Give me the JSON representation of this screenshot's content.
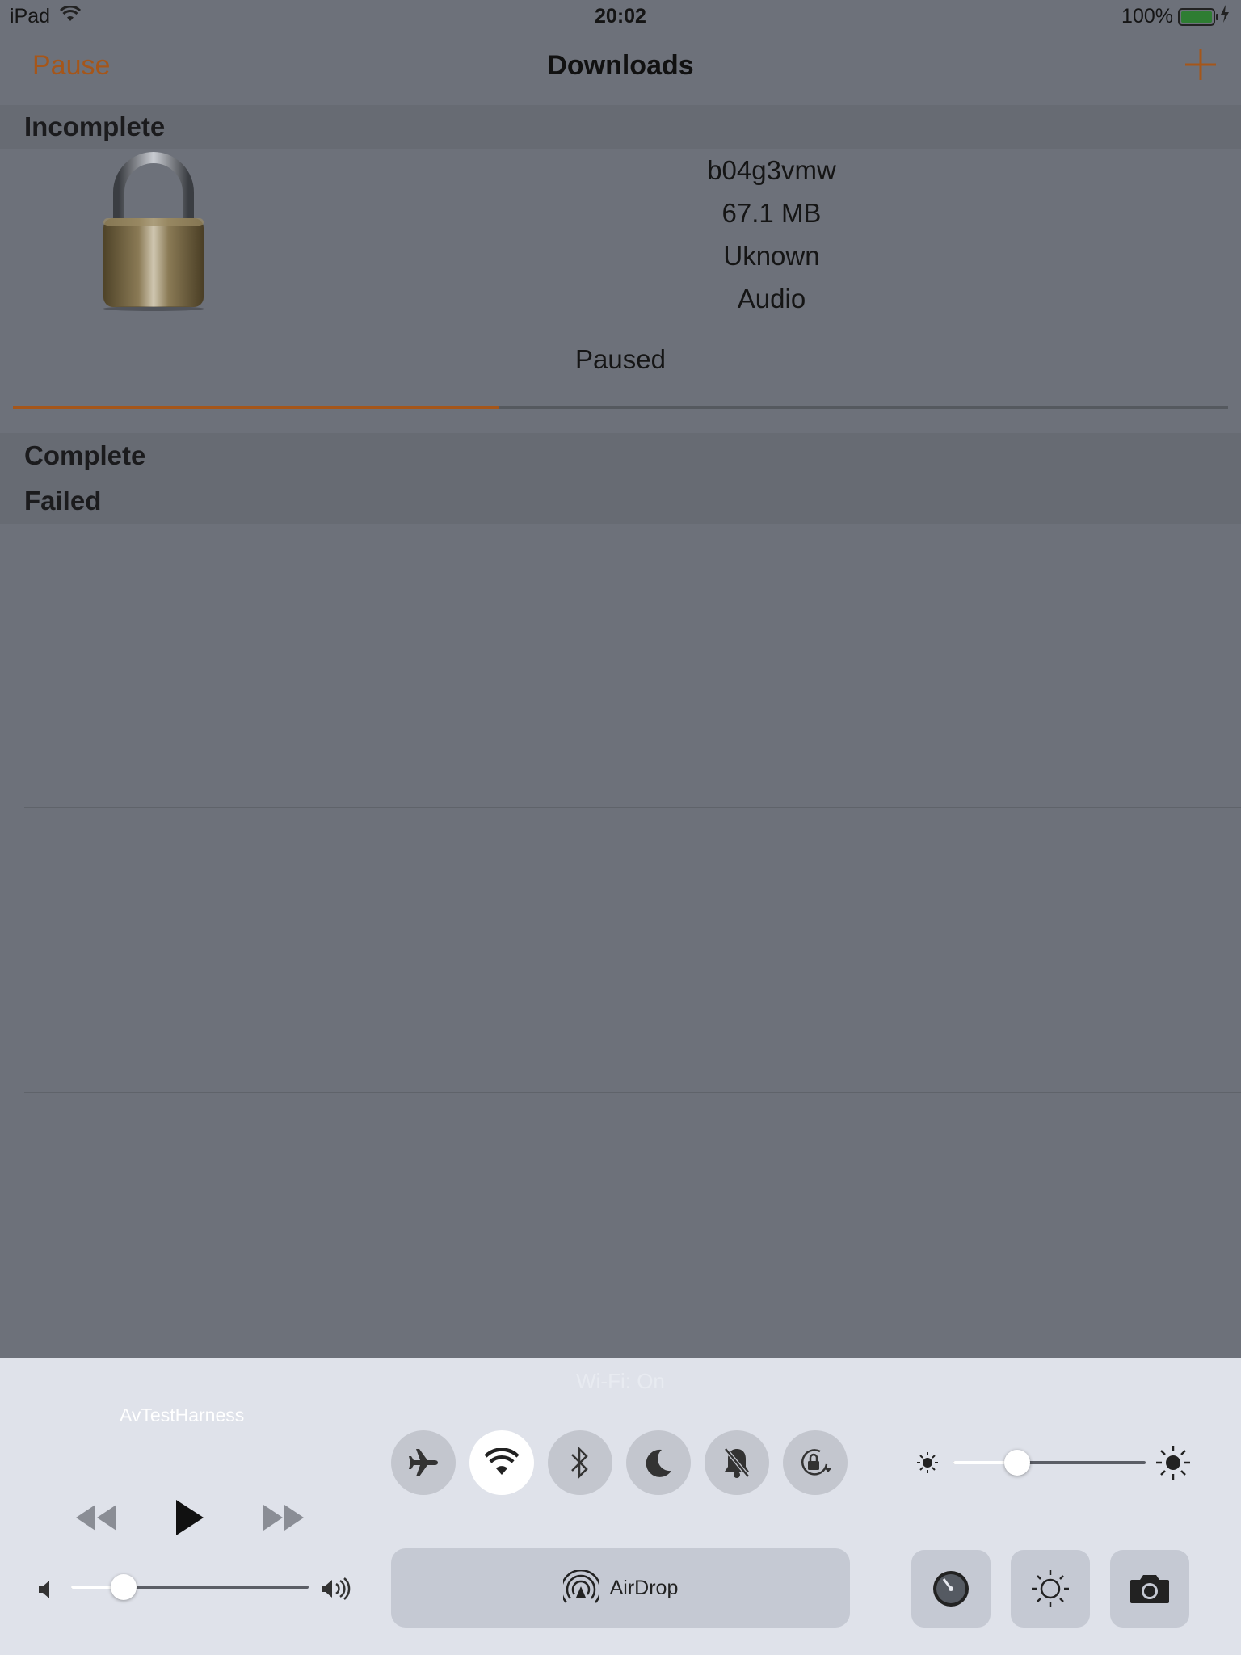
{
  "status_bar": {
    "device": "iPad",
    "time": "20:02",
    "battery": "100%"
  },
  "nav": {
    "left_button": "Pause",
    "title": "Downloads",
    "add_icon": "plus-icon"
  },
  "sections": {
    "incomplete": "Incomplete",
    "complete": "Complete",
    "failed": "Failed"
  },
  "download": {
    "name": "b04g3vmw",
    "size": "67.1 MB",
    "date": "Uknown",
    "type": "Audio",
    "status": "Paused",
    "progress_percent": 40,
    "thumbnail_icon": "padlock-icon"
  },
  "control_center": {
    "wifi_note": "Wi-Fi: On",
    "now_playing_app": "AvTestHarness",
    "airdrop_label": "AirDrop",
    "volume_percent": 22,
    "brightness_percent": 33,
    "toggles": [
      "airplane-mode",
      "wifi",
      "bluetooth",
      "do-not-disturb",
      "silent",
      "rotation-lock"
    ],
    "active_toggle": "wifi",
    "shortcuts": [
      "timer",
      "night-shift",
      "camera"
    ],
    "colors": {
      "accent": "#a5561a",
      "panel": "#dfe2ea"
    }
  }
}
